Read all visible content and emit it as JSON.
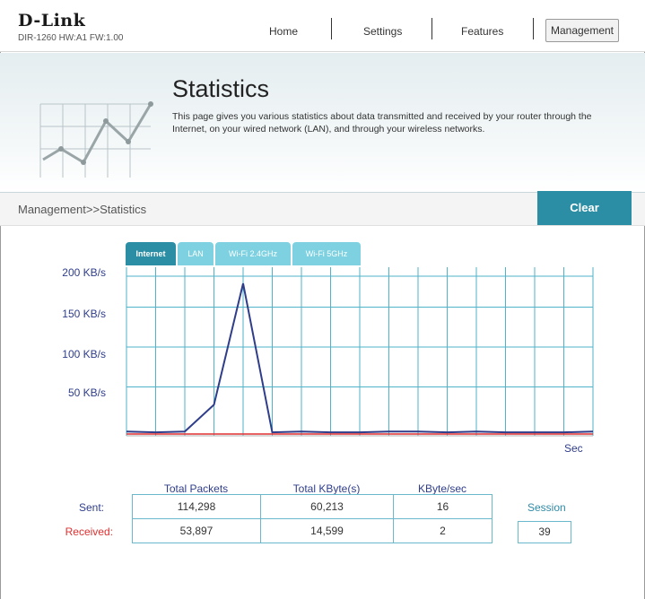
{
  "header": {
    "logo": "D-Link",
    "model_info": "DIR-1260 HW:A1 FW:1.00",
    "nav": [
      "Home",
      "Settings",
      "Features",
      "Management"
    ],
    "active_nav": "Management"
  },
  "banner": {
    "title": "Statistics",
    "description": "This page gives you various statistics about data transmitted and received by your router through the Internet, on your wired network (LAN), and through your wireless networks."
  },
  "breadcrumb": "Management>>Statistics",
  "clear_label": "Clear",
  "tabs": [
    "Internet",
    "LAN",
    "Wi-Fi 2.4GHz",
    "Wi-Fi 5GHz"
  ],
  "active_tab": "Internet",
  "chart_data": {
    "type": "line",
    "y_tick_labels": [
      "200 KB/s",
      "150 KB/s",
      "100 KB/s",
      "50 KB/s"
    ],
    "xlabel": "Sec",
    "ylim": [
      0,
      200
    ],
    "x": [
      0,
      1,
      2,
      3,
      4,
      5,
      6,
      7,
      8,
      9,
      10,
      11,
      12,
      13,
      14,
      15,
      16
    ],
    "series": [
      {
        "name": "",
        "color": "#2f3d8a",
        "values": [
          3,
          2,
          3,
          35,
          180,
          2,
          3,
          2,
          2,
          3,
          3,
          2,
          3,
          2,
          2,
          2,
          3
        ]
      },
      {
        "name": "",
        "color": "#e03030",
        "values": [
          0,
          0,
          0,
          0,
          0,
          0,
          0,
          0,
          0,
          0,
          0,
          0,
          0,
          0,
          0,
          0,
          0
        ]
      }
    ],
    "grid": true
  },
  "stats": {
    "columns": [
      "Total Packets",
      "Total KByte(s)",
      "KByte/sec"
    ],
    "sent_label": "Sent:",
    "received_label": "Received:",
    "sent": [
      "114,298",
      "60,213",
      "16"
    ],
    "received": [
      "53,897",
      "14,599",
      "2"
    ],
    "session_label": "Session",
    "session_value": "39",
    "colors": {
      "sent": "#2f3d8a",
      "received": "#e03030"
    }
  }
}
